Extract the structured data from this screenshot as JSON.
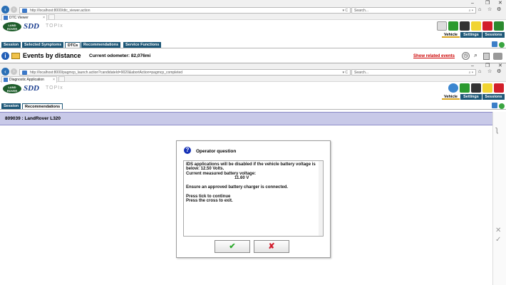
{
  "browser1": {
    "url": "http://localhost:8000/dtc_viewer.action",
    "url_tail": "▾ C",
    "search_placeholder": "Search...",
    "search_tail": "⌕ ▾",
    "tab_title": "DTC Viewer",
    "tab_close": "×"
  },
  "browser2": {
    "url": "http://localhost:8000/pagmcp_launch.action?candidateId=9020&abortAction=pagmcp_completed",
    "url_tail": "▾ C",
    "search_placeholder": "Search...",
    "search_tail": "⌕ ▾",
    "tab_title": "Diagnostic Application",
    "tab_close": "×"
  },
  "window_controls": {
    "minimize": "–",
    "restore": "❐",
    "close": "✕"
  },
  "sdd1": {
    "logo_text": "LAND ROVER",
    "brand": "SDD",
    "product": "TOPIx",
    "right_tabs": [
      "Vehicle",
      "Settings",
      "Sessions"
    ],
    "menu": [
      "Session",
      "Selected Symptoms",
      "DTCs",
      "Recommendations",
      "Service Functions"
    ]
  },
  "events": {
    "title": "Events by distance",
    "odometer_label": "Current odometer:",
    "odometer_value": "82,076mi",
    "related_link": "Show related events"
  },
  "sdd2": {
    "logo_text": "LAND ROVER",
    "brand": "SDD",
    "product": "TOPIx",
    "right_tabs": [
      "Vehicle",
      "Settings",
      "Sessions"
    ],
    "menu": [
      "Session",
      "Recommendations"
    ]
  },
  "vehicle": {
    "label": "809039 : LandRover L320"
  },
  "dialog": {
    "title": "Operator question",
    "lines": [
      "IDS applications will be disabled if the vehicle battery voltage is",
      "below: 12.50 Volts.",
      "Current measured battery voltage:",
      "11.60 V",
      "",
      "Ensure an approved battery charger is connected.",
      "",
      "Press tick to continue",
      "Press the cross to exit."
    ],
    "ok_glyph": "✔",
    "cancel_glyph": "✘"
  },
  "side_icons": {
    "cross": "✕",
    "tick": "✓"
  },
  "colors": {
    "menu_bg": "#1d5777",
    "vehicle_bar": "#c8c9e8",
    "link_red": "#cc0000",
    "ok_green": "#2eaa2e",
    "cancel_red": "#d11b2c"
  }
}
